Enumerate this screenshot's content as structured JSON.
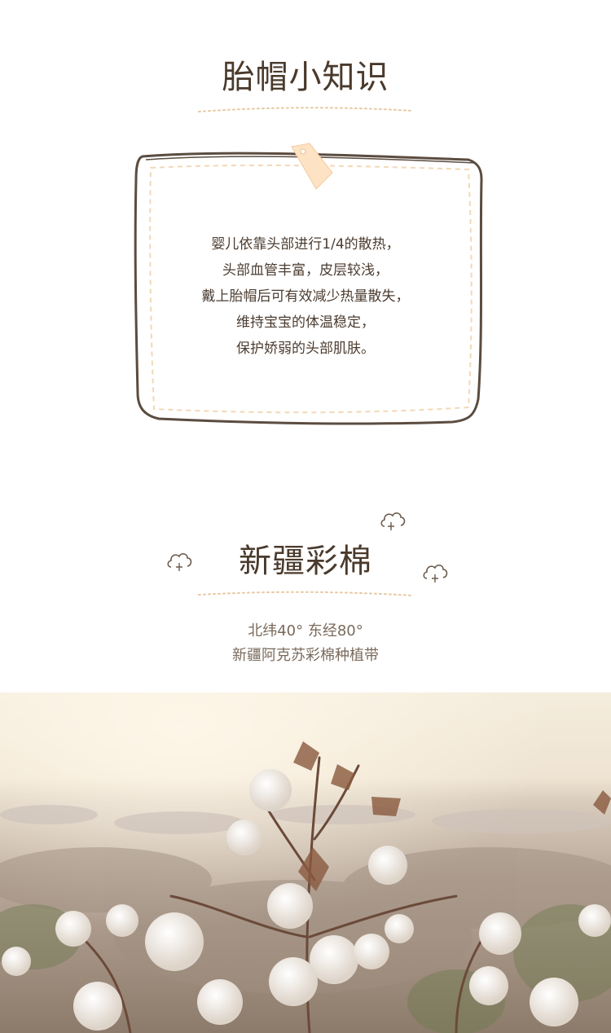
{
  "knowledge": {
    "title": "胎帽小知识",
    "lines": [
      "婴儿依靠头部进行1/4的散热，",
      "头部血管丰富，皮层较浅，",
      "戴上胎帽后可有效减少热量散失，",
      "维持宝宝的体温稳定，",
      "保护娇弱的头部肌肤。"
    ]
  },
  "cotton": {
    "title": "新疆彩棉",
    "subtitle_line1": "北纬40° 东经80°",
    "subtitle_line2": "新疆阿克苏彩棉种植带"
  },
  "colors": {
    "accent_line": "#e8c9a0",
    "card_border": "#5b4c40",
    "tag": "#fde3c4"
  },
  "icons": [
    "cloud-cotton-icon",
    "price-tag-icon"
  ]
}
